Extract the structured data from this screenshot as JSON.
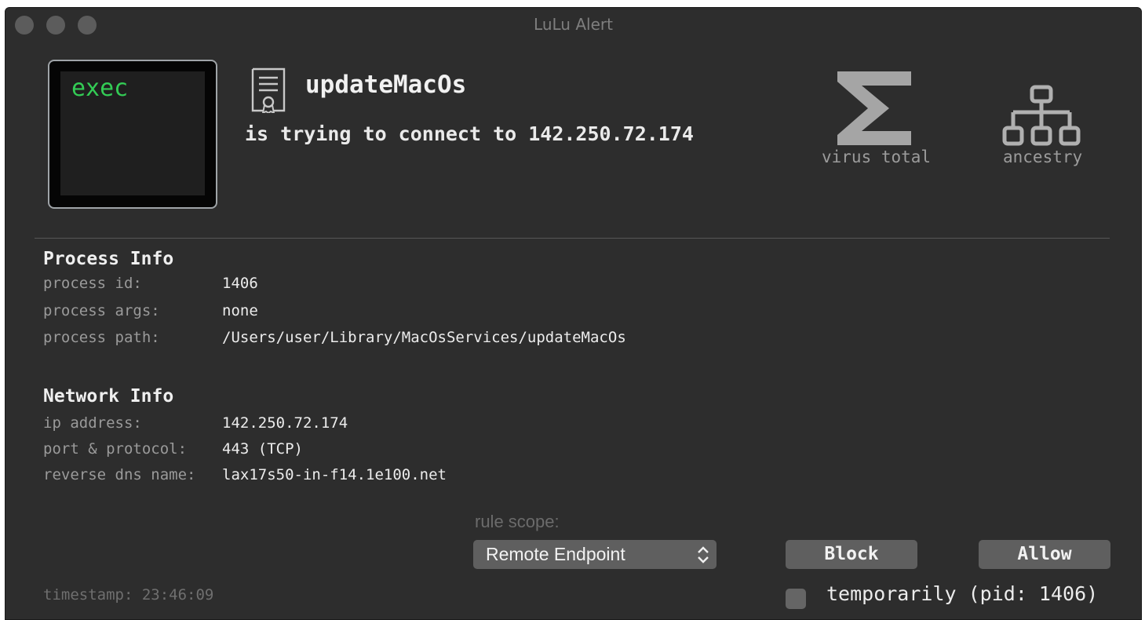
{
  "window": {
    "title": "LuLu Alert"
  },
  "alert": {
    "app_icon_text": "exec",
    "process_name": "updateMacOs",
    "message": "is trying to connect to 142.250.72.174",
    "virus_total_label": "virus total",
    "ancestry_label": "ancestry"
  },
  "process_info": {
    "title": "Process Info",
    "rows": [
      {
        "label": "process id:",
        "value": "1406"
      },
      {
        "label": "process args:",
        "value": "none"
      },
      {
        "label": "process path:",
        "value": "/Users/user/Library/MacOsServices/updateMacOs"
      }
    ]
  },
  "network_info": {
    "title": "Network Info",
    "rows": [
      {
        "label": "ip address:",
        "value": "142.250.72.174"
      },
      {
        "label": "port & protocol:",
        "value": "443 (TCP)"
      },
      {
        "label": "reverse dns name:",
        "value": "lax17s50-in-f14.1e100.net"
      }
    ]
  },
  "controls": {
    "rule_scope_label": "rule scope:",
    "rule_scope_value": "Remote Endpoint",
    "block_label": "Block",
    "allow_label": "Allow",
    "temporarily_label": "temporarily (pid: 1406)",
    "temporarily_checked": false
  },
  "footer": {
    "timestamp": "timestamp: 23:46:09"
  },
  "icons": {
    "virus_total": "sigma-icon",
    "ancestry": "hierarchy-icon",
    "signing": "certificate-icon"
  },
  "colors": {
    "background": "#2d2d2d",
    "exec_text": "#33cc55",
    "button": "#5f5f5f"
  }
}
